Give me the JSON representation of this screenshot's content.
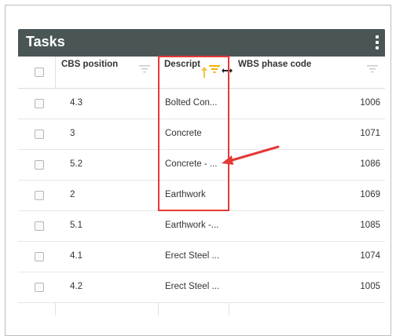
{
  "panel": {
    "title": "Tasks"
  },
  "columns": {
    "cbs": "CBS position",
    "description": "Descript",
    "wbs": "WBS phase code"
  },
  "rows": [
    {
      "cbs": "4.3",
      "description": "Bolted Con...",
      "wbs": "1006"
    },
    {
      "cbs": "3",
      "description": "Concrete",
      "wbs": "1071"
    },
    {
      "cbs": "5.2",
      "description": "Concrete - ...",
      "wbs": "1086"
    },
    {
      "cbs": "2",
      "description": "Earthwork",
      "wbs": "1069"
    },
    {
      "cbs": "5.1",
      "description": "Earthwork -...",
      "wbs": "1085"
    },
    {
      "cbs": "4.1",
      "description": "Erect Steel ...",
      "wbs": "1074"
    },
    {
      "cbs": "4.2",
      "description": "Erect Steel ...",
      "wbs": "1005"
    }
  ],
  "icons": {
    "menu": "kebab-menu-icon",
    "filter": "filter-icon",
    "sort": "sort-arrow-icon",
    "resize": "column-resize-icon",
    "callout": "annotation-arrow-icon"
  },
  "colors": {
    "titlebar": "#4a5556",
    "highlight": "#e53935",
    "active_filter": "#f4b400"
  }
}
